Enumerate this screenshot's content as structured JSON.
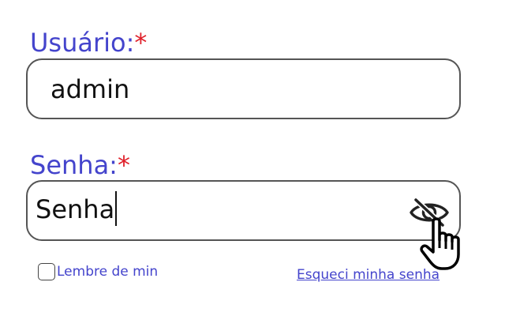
{
  "username": {
    "label": "Usuário:",
    "required_mark": "*",
    "value": "admin"
  },
  "password": {
    "label": "Senha:",
    "required_mark": "*",
    "value": "Senha",
    "toggle_icon": "eye-slash-icon"
  },
  "remember": {
    "label": "Lembre de min",
    "checked": false
  },
  "forgot_link": "Esqueci minha senha",
  "colors": {
    "label": "#4444cc",
    "required": "#e0202a",
    "border": "#555555"
  },
  "cursor_icon": "pointer-hand-icon"
}
